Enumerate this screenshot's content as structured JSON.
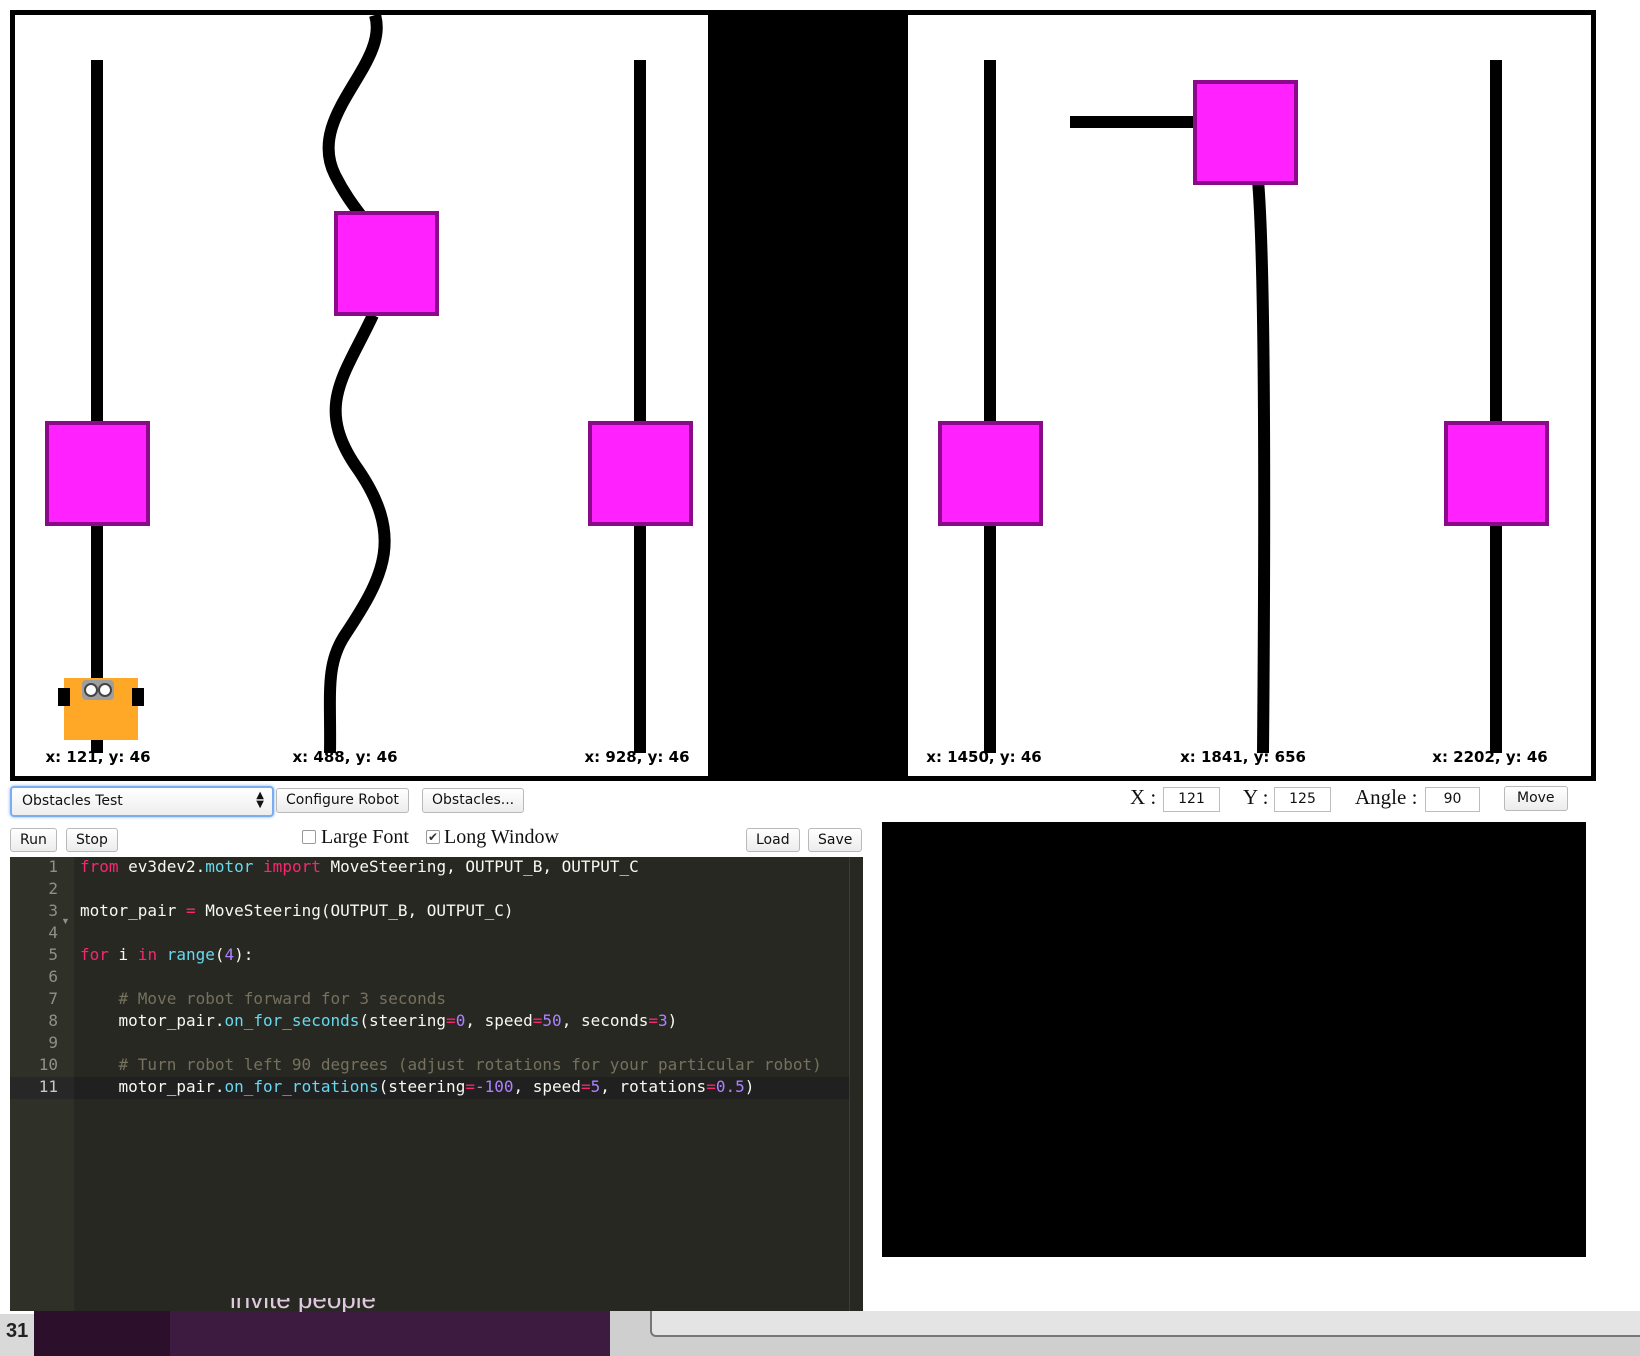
{
  "arena": {
    "coordinates": [
      "x: 121, y: 46",
      "x: 488, y: 46",
      "x: 928, y: 46",
      "x: 1450, y: 46",
      "x: 1841, y: 656",
      "x: 2202, y: 46"
    ],
    "colors": {
      "obstacle_fill": "#ff22ff",
      "obstacle_border": "#8a0a8a",
      "line": "#000000",
      "robot_body": "#ffa726"
    }
  },
  "toolbar": {
    "world_select": "Obstacles Test",
    "configure_robot": "Configure Robot",
    "obstacles": "Obstacles...",
    "x_label": "X :",
    "x_value": "121",
    "y_label": "Y :",
    "y_value": "125",
    "angle_label": "Angle :",
    "angle_value": "90",
    "move": "Move"
  },
  "editor_toolbar": {
    "run": "Run",
    "stop": "Stop",
    "large_font": "Large Font",
    "long_window": "Long Window",
    "load": "Load",
    "save": "Save"
  },
  "editor": {
    "line_numbers": [
      "1",
      "2",
      "3",
      "4",
      "5",
      "6",
      "7",
      "8",
      "9",
      "10",
      "11"
    ],
    "lines": [
      [
        {
          "t": "from",
          "c": "kw"
        },
        {
          "t": " ev3dev2."
        },
        {
          "t": "motor",
          "c": "fn"
        },
        {
          "t": " "
        },
        {
          "t": "import",
          "c": "kw"
        },
        {
          "t": " MoveSteering, OUTPUT_B, OUTPUT_C"
        }
      ],
      [],
      [
        {
          "t": "motor_pair "
        },
        {
          "t": "=",
          "c": "op"
        },
        {
          "t": " MoveSteering(OUTPUT_B, OUTPUT_C)"
        }
      ],
      [],
      [
        {
          "t": "for",
          "c": "kw"
        },
        {
          "t": " i "
        },
        {
          "t": "in",
          "c": "kw"
        },
        {
          "t": " "
        },
        {
          "t": "range",
          "c": "fn"
        },
        {
          "t": "("
        },
        {
          "t": "4",
          "c": "num"
        },
        {
          "t": "):"
        }
      ],
      [],
      [
        {
          "t": "    "
        },
        {
          "t": "# Move robot forward for 3 seconds",
          "c": "cm"
        }
      ],
      [
        {
          "t": "    motor_pair."
        },
        {
          "t": "on_for_seconds",
          "c": "fn"
        },
        {
          "t": "(steering"
        },
        {
          "t": "=",
          "c": "op"
        },
        {
          "t": "0",
          "c": "num"
        },
        {
          "t": ", speed"
        },
        {
          "t": "=",
          "c": "op"
        },
        {
          "t": "50",
          "c": "num"
        },
        {
          "t": ", seconds"
        },
        {
          "t": "=",
          "c": "op"
        },
        {
          "t": "3",
          "c": "num"
        },
        {
          "t": ")"
        }
      ],
      [],
      [
        {
          "t": "    "
        },
        {
          "t": "# Turn robot left 90 degrees (adjust rotations for your particular robot)",
          "c": "cm"
        }
      ],
      [
        {
          "t": "    motor_pair."
        },
        {
          "t": "on_for_rotations",
          "c": "fn"
        },
        {
          "t": "(steering"
        },
        {
          "t": "=",
          "c": "op"
        },
        {
          "t": "-100",
          "c": "num"
        },
        {
          "t": ", speed"
        },
        {
          "t": "=",
          "c": "op"
        },
        {
          "t": "5",
          "c": "num"
        },
        {
          "t": ", rotations"
        },
        {
          "t": "=",
          "c": "op"
        },
        {
          "t": "0.5",
          "c": "num"
        },
        {
          "t": ")"
        }
      ]
    ]
  },
  "background": {
    "fragment_text": "invite people",
    "fragment_number": "31"
  }
}
